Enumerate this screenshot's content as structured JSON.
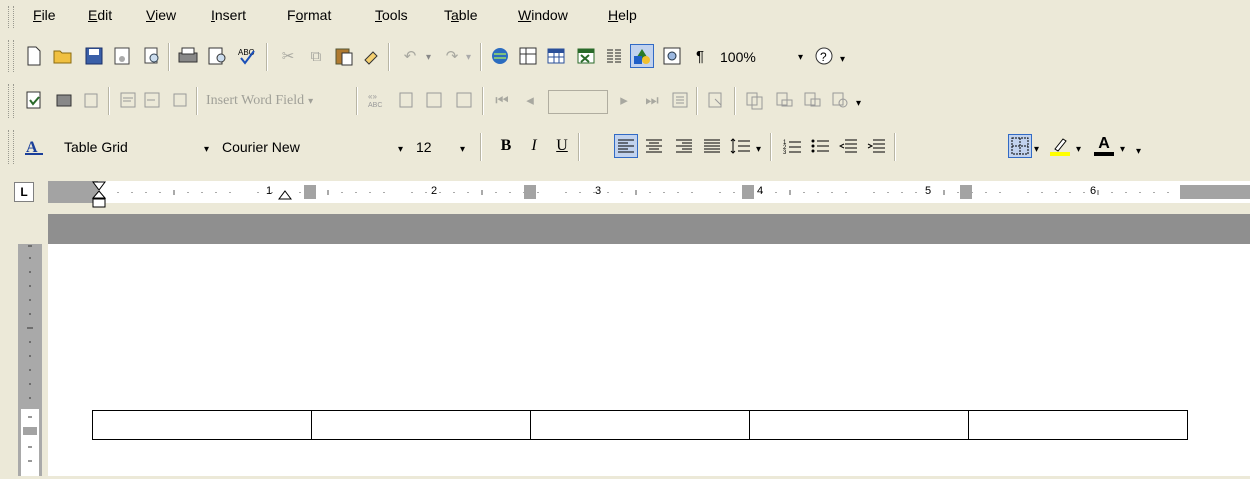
{
  "menubar": {
    "items": [
      {
        "label": "File"
      },
      {
        "label": "Edit"
      },
      {
        "label": "View"
      },
      {
        "label": "Insert"
      },
      {
        "label": "Format"
      },
      {
        "label": "Tools"
      },
      {
        "label": "Table"
      },
      {
        "label": "Window"
      },
      {
        "label": "Help"
      }
    ]
  },
  "standard_toolbar": {
    "zoom": "100%",
    "icons": [
      "new-icon",
      "open-icon",
      "save-icon",
      "permission-icon",
      "search-icon",
      "print-icon",
      "print-preview-icon",
      "spelling-icon",
      "cut-icon",
      "copy-icon",
      "paste-icon",
      "format-painter-icon",
      "undo-icon",
      "redo-icon",
      "hyperlink-icon",
      "tables-borders-icon",
      "insert-table-icon",
      "insert-excel-icon",
      "columns-icon",
      "drawing-icon",
      "document-map-icon",
      "show-formatting-icon",
      "help-icon"
    ]
  },
  "mail_merge_toolbar": {
    "insert_word_field": "Insert Word Field"
  },
  "formatting_toolbar": {
    "style": "Table Grid",
    "font": "Courier New",
    "size": "12",
    "bold": "B",
    "italic": "I",
    "underline": "U",
    "font_color_letter": "A",
    "highlight_color": "#ffff00",
    "font_color": "#000000"
  },
  "ruler": {
    "tab_selector": "L",
    "numbers": [
      "1",
      "2",
      "3",
      "4",
      "5",
      "6"
    ]
  },
  "document": {
    "table": {
      "rows": 1,
      "cols": 5,
      "cells": [
        "",
        "",
        "",
        "",
        ""
      ]
    }
  }
}
